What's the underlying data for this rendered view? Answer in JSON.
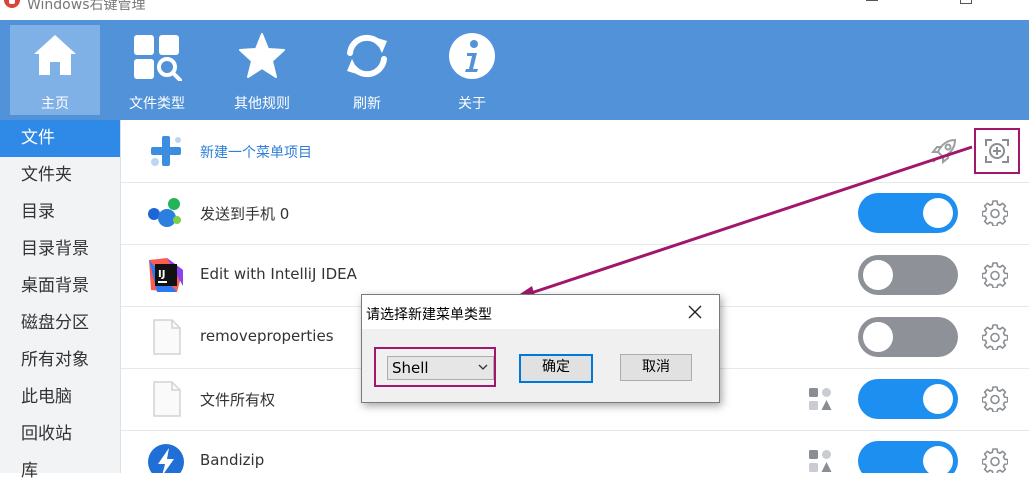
{
  "window": {
    "title": "Windows右键管理"
  },
  "toolbar": {
    "items": [
      {
        "label": "主页"
      },
      {
        "label": "文件类型"
      },
      {
        "label": "其他规则"
      },
      {
        "label": "刷新"
      },
      {
        "label": "关于"
      }
    ]
  },
  "sidebar": {
    "items": [
      {
        "label": "文件"
      },
      {
        "label": "文件夹"
      },
      {
        "label": "目录"
      },
      {
        "label": "目录背景"
      },
      {
        "label": "桌面背景"
      },
      {
        "label": "磁盘分区"
      },
      {
        "label": "所有对象"
      },
      {
        "label": "此电脑"
      },
      {
        "label": "回收站"
      },
      {
        "label": "库"
      }
    ]
  },
  "list": {
    "new_item_label": "新建一个菜单项目",
    "items": [
      {
        "label": "发送到手机 0",
        "enabled": true
      },
      {
        "label": "Edit with IntelliJ IDEA",
        "enabled": false
      },
      {
        "label": "removeproperties",
        "enabled": false
      },
      {
        "label": "文件所有权",
        "enabled": true
      },
      {
        "label": "Bandizip",
        "enabled": true
      }
    ]
  },
  "dialog": {
    "title": "请选择新建菜单类型",
    "select_value": "Shell",
    "ok_label": "确定",
    "cancel_label": "取消"
  },
  "colors": {
    "toolbar": "#5192d9",
    "accent": "#2e8ae6",
    "toggle_on": "#1d8ff0",
    "toggle_off": "#8e9298",
    "annotation": "#a0176b"
  }
}
